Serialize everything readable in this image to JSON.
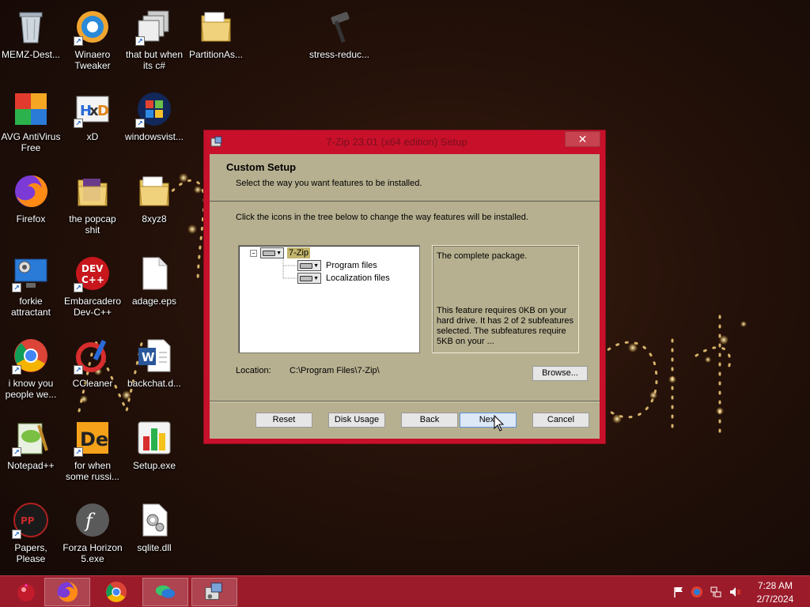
{
  "desktop": {
    "icons": [
      {
        "label": "MEMZ-Dest...",
        "icon": "recycle-bin-icon"
      },
      {
        "label": "Winaero Tweaker",
        "icon": "winaero-icon"
      },
      {
        "label": "that but when its c#",
        "icon": "windows-copy-icon"
      },
      {
        "label": "PartitionAs...",
        "icon": "folder-icon"
      },
      {
        "label": "stress-reduc...",
        "icon": "hammer-icon"
      },
      {
        "label": "AVG AntiVirus Free",
        "icon": "avg-icon"
      },
      {
        "label": "xD",
        "icon": "hxd-icon"
      },
      {
        "label": "windowsvist...",
        "icon": "windows-vista-icon"
      },
      {
        "label": "Firefox",
        "icon": "firefox-icon"
      },
      {
        "label": "the popcap shit",
        "icon": "folder-icon"
      },
      {
        "label": "8xyz8",
        "icon": "folder-icon"
      },
      {
        "label": "forkie attractant",
        "icon": "monitor-gear-icon"
      },
      {
        "label": "Embarcadero Dev-C++",
        "icon": "devcpp-icon"
      },
      {
        "label": "adage.eps",
        "icon": "file-icon"
      },
      {
        "label": "i know you people we...",
        "icon": "chrome-icon"
      },
      {
        "label": "CCleaner",
        "icon": "ccleaner-icon"
      },
      {
        "label": "backchat.d...",
        "icon": "word-document-icon"
      },
      {
        "label": "Notepad++",
        "icon": "notepad-plus-icon"
      },
      {
        "label": "for when some russi...",
        "icon": "de-icon"
      },
      {
        "label": "Setup.exe",
        "icon": "setup-chart-icon"
      },
      {
        "label": "Papers, Please",
        "icon": "papers-please-icon"
      },
      {
        "label": "Forza Horizon 5.exe",
        "icon": "flash-icon"
      },
      {
        "label": "sqlite.dll",
        "icon": "dll-gear-icon"
      }
    ]
  },
  "window": {
    "title": "7-Zip 23.01 (x64 edition) Setup",
    "close_label": "✕",
    "header_title": "Custom Setup",
    "header_subtitle": "Select the way you want features to be installed.",
    "instruction": "Click the icons in the tree below to change the way features will be installed.",
    "tree": {
      "root": "7-Zip",
      "children": [
        "Program files",
        "Localization files"
      ]
    },
    "description": {
      "summary": "The complete package.",
      "details": "This feature requires 0KB on your hard drive. It has 2 of 2 subfeatures selected. The subfeatures require 5KB on your ..."
    },
    "location_label": "Location:",
    "location_value": "C:\\Program Files\\7-Zip\\",
    "buttons": {
      "browse": "Browse...",
      "reset": "Reset",
      "disk_usage": "Disk Usage",
      "back": "Back",
      "next": "Next",
      "cancel": "Cancel"
    }
  },
  "taskbar": {
    "apps": [
      "firefox-icon",
      "chrome-icon",
      "chat-icon",
      "installer-icon"
    ],
    "tray": [
      "flag-icon",
      "security-icon",
      "network-icon",
      "volume-muted-icon"
    ],
    "time": "7:28 AM",
    "date": "2/7/2024"
  },
  "colors": {
    "window_frame": "#c8102b",
    "dialog_body": "#b7b090",
    "taskbar": "#9b1b2a"
  }
}
